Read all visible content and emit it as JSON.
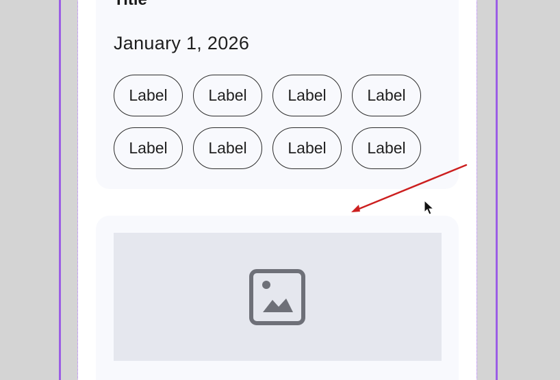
{
  "card": {
    "title": "Title",
    "date": "January 1, 2026",
    "chips": [
      {
        "label": "Label"
      },
      {
        "label": "Label"
      },
      {
        "label": "Label"
      },
      {
        "label": "Label"
      },
      {
        "label": "Label"
      },
      {
        "label": "Label"
      },
      {
        "label": "Label"
      },
      {
        "label": "Label"
      }
    ]
  },
  "media_card": {
    "image_icon": "image-icon"
  },
  "colors": {
    "frame_border": "#9b5de5",
    "card_bg": "#f8f9fd",
    "placeholder_bg": "#e5e7ee",
    "icon": "#6e7078",
    "arrow": "#cc1f1f"
  }
}
